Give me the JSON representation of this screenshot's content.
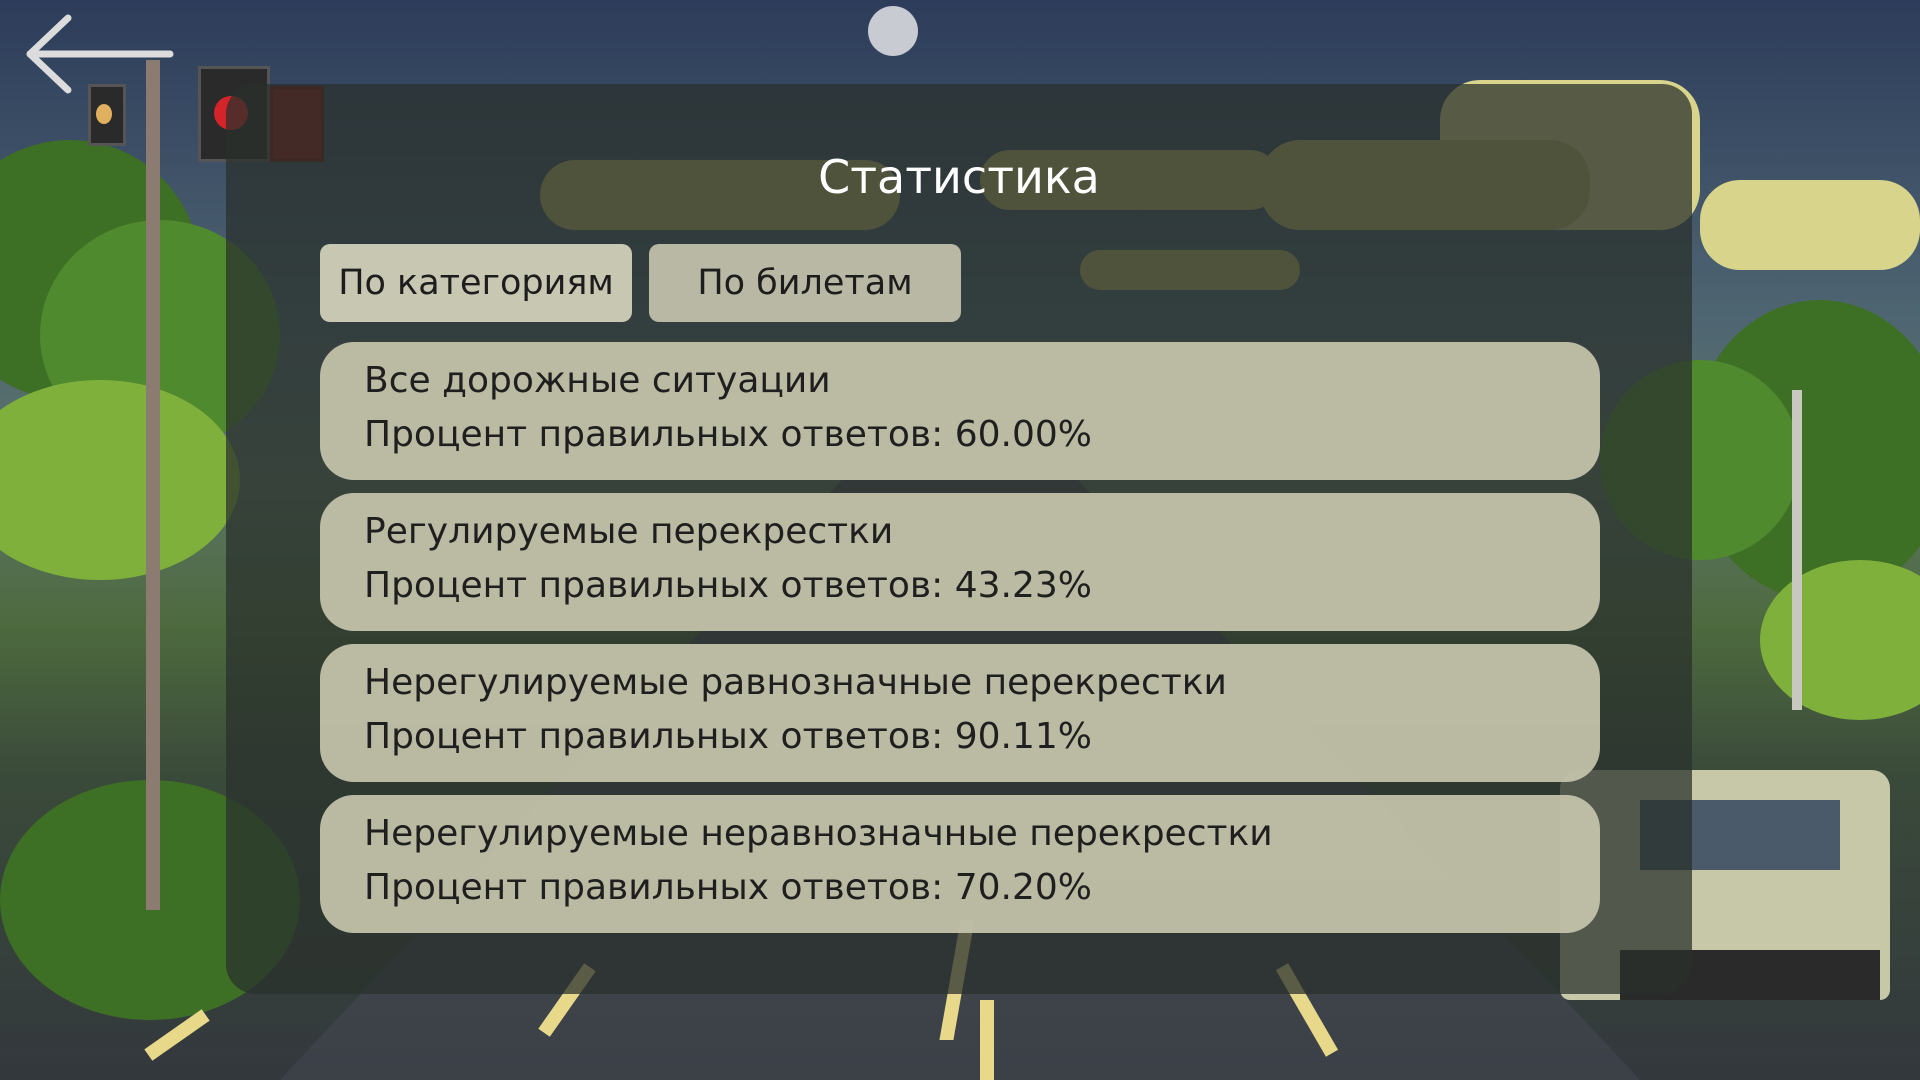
{
  "screen": {
    "title": "Статистика"
  },
  "back": {
    "icon": "arrow-left-icon"
  },
  "tabs": [
    {
      "label": "По категориям",
      "active": true
    },
    {
      "label": "По билетам",
      "active": false
    }
  ],
  "stats": {
    "percent_label": "Процент правильных ответов:",
    "items": [
      {
        "category": "Все дорожные ситуации",
        "percent": "60.00%"
      },
      {
        "category": "Регулируемые перекрестки",
        "percent": "43.23%"
      },
      {
        "category": "Нерегулируемые равнозначные перекрестки",
        "percent": "90.11%"
      },
      {
        "category": "Нерегулируемые неравнозначные перекрестки",
        "percent": "70.20%"
      }
    ]
  },
  "colors": {
    "panel": "#2a302c",
    "card": "#c4c2aa",
    "tab": "#b9b8a4",
    "title_text": "#ffffff",
    "card_text": "#1f1f1f"
  }
}
